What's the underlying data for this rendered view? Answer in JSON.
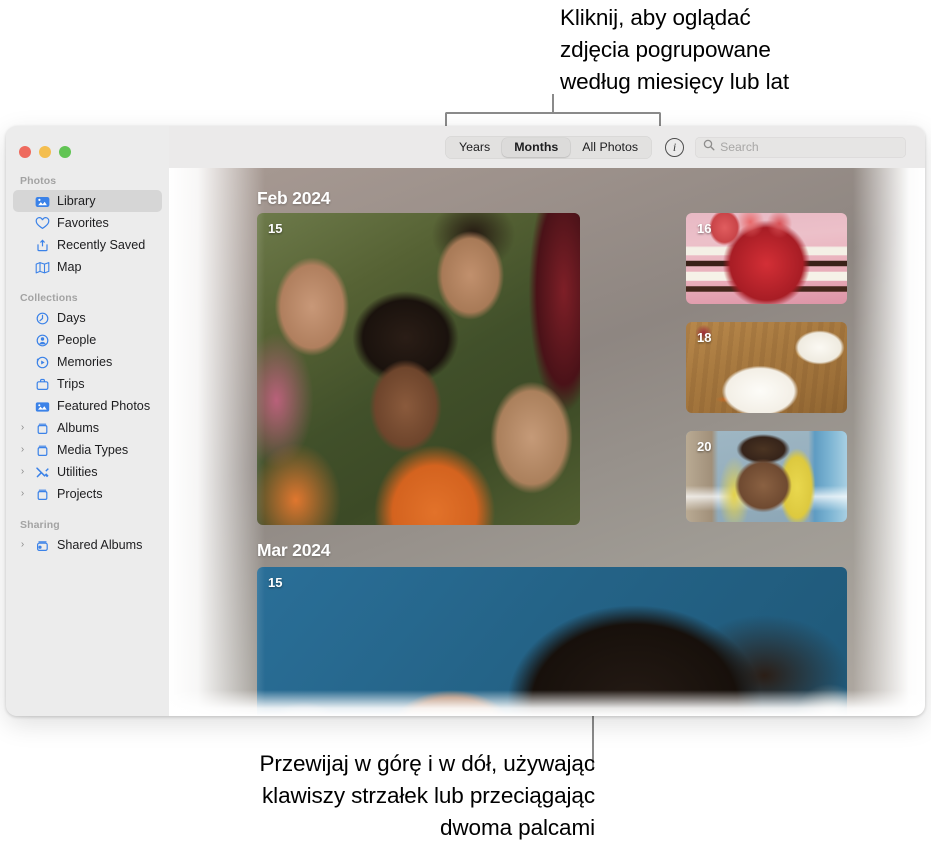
{
  "callouts": {
    "top": "Kliknij, aby oglądać\nzdjęcia pogrupowane\nwedług miesięcy lub lat",
    "bottom": "Przewijaj w górę i w dół, używając\nklawiszy strzałek lub przeciągając\ndwoma palcami"
  },
  "window": {
    "traffic_lights": {
      "close_color": "#ee6a5e",
      "minimize_color": "#f4be4f",
      "zoom_color": "#61c454"
    }
  },
  "sidebar": {
    "groups": [
      {
        "title": "Photos",
        "items": [
          {
            "label": "Library",
            "icon": "library-icon",
            "selected": true,
            "disclosure": false
          },
          {
            "label": "Favorites",
            "icon": "heart-icon",
            "selected": false,
            "disclosure": false
          },
          {
            "label": "Recently Saved",
            "icon": "recently-saved-icon",
            "selected": false,
            "disclosure": false
          },
          {
            "label": "Map",
            "icon": "map-icon",
            "selected": false,
            "disclosure": false
          }
        ]
      },
      {
        "title": "Collections",
        "items": [
          {
            "label": "Days",
            "icon": "clock-icon",
            "selected": false,
            "disclosure": false
          },
          {
            "label": "People",
            "icon": "person-circle-icon",
            "selected": false,
            "disclosure": false
          },
          {
            "label": "Memories",
            "icon": "memories-play-icon",
            "selected": false,
            "disclosure": false
          },
          {
            "label": "Trips",
            "icon": "suitcase-icon",
            "selected": false,
            "disclosure": false
          },
          {
            "label": "Featured Photos",
            "icon": "featured-photo-icon",
            "selected": false,
            "disclosure": false
          },
          {
            "label": "Albums",
            "icon": "album-icon",
            "selected": false,
            "disclosure": true
          },
          {
            "label": "Media Types",
            "icon": "album-icon",
            "selected": false,
            "disclosure": true
          },
          {
            "label": "Utilities",
            "icon": "utilities-icon",
            "selected": false,
            "disclosure": true
          },
          {
            "label": "Projects",
            "icon": "album-icon",
            "selected": false,
            "disclosure": true
          }
        ]
      },
      {
        "title": "Sharing",
        "items": [
          {
            "label": "Shared Albums",
            "icon": "shared-album-icon",
            "selected": false,
            "disclosure": true
          }
        ]
      }
    ]
  },
  "toolbar": {
    "segments": [
      {
        "label": "Years",
        "active": false
      },
      {
        "label": "Months",
        "active": true
      },
      {
        "label": "All Photos",
        "active": false
      }
    ],
    "info_label": "i",
    "search": {
      "placeholder": "Search",
      "value": ""
    }
  },
  "library": {
    "sections": [
      {
        "header": "Feb 2024",
        "photos": [
          {
            "day": "15",
            "art": "art-selfie",
            "role": "hero"
          },
          {
            "day": "16",
            "art": "art-cake",
            "role": "thumb"
          },
          {
            "day": "18",
            "art": "art-food",
            "role": "thumb"
          },
          {
            "day": "20",
            "art": "art-beach",
            "role": "thumb"
          }
        ]
      },
      {
        "header": "Mar 2024",
        "photos": [
          {
            "day": "15",
            "art": "art-blue",
            "role": "hero"
          }
        ]
      }
    ]
  }
}
